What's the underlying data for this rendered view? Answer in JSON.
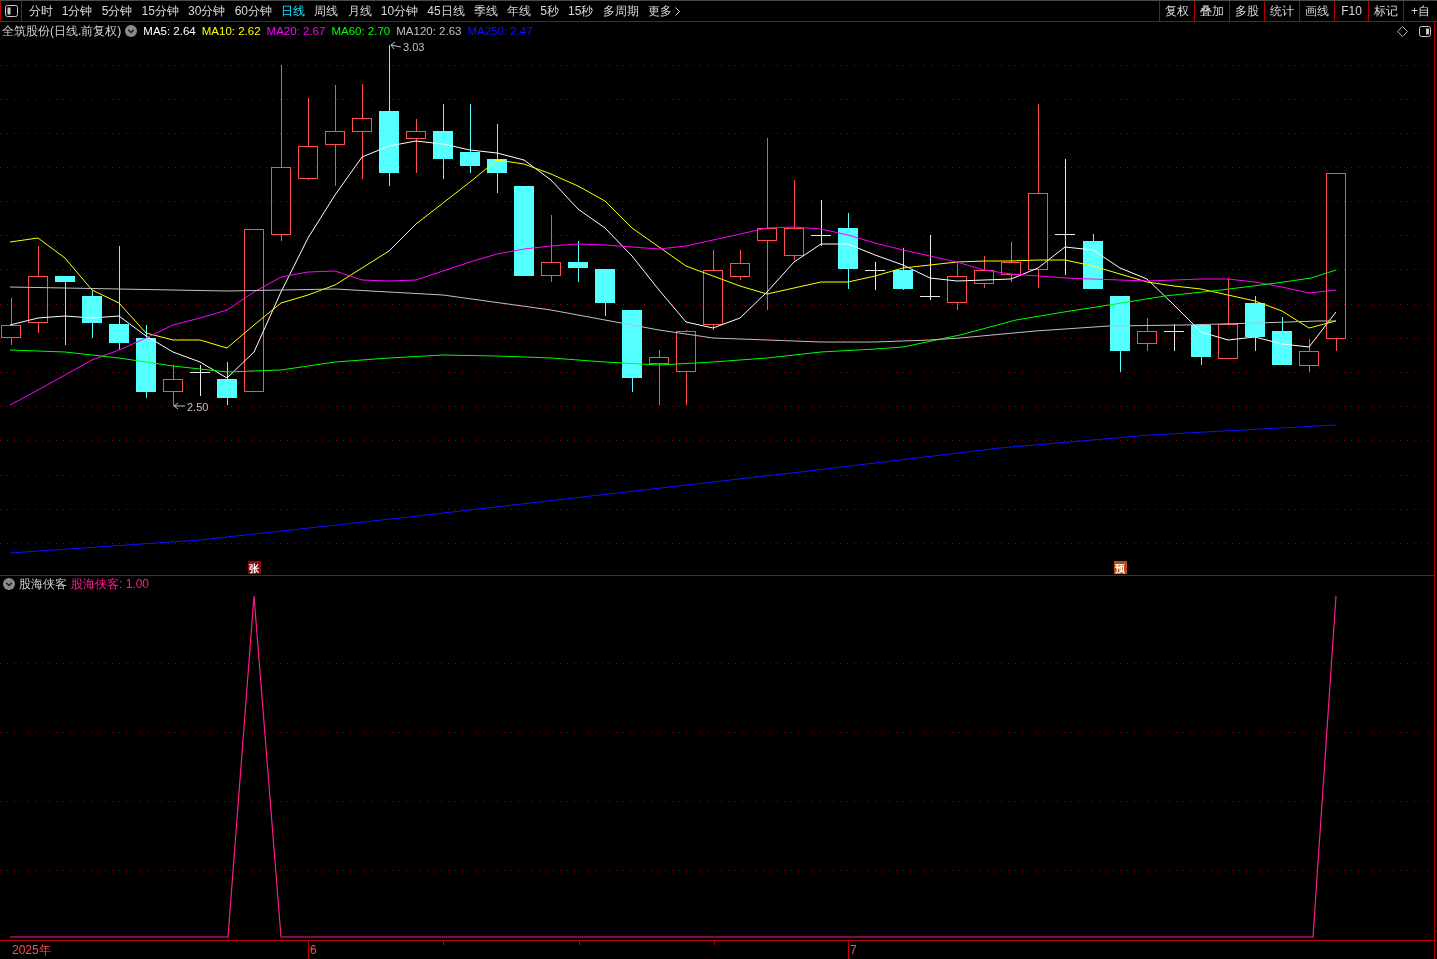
{
  "toolbar": {
    "periods": [
      {
        "label": "分时",
        "kind": "period",
        "selected": false
      },
      {
        "label": "1分钟",
        "kind": "period",
        "selected": false
      },
      {
        "label": "5分钟",
        "kind": "period",
        "selected": false
      },
      {
        "label": "15分钟",
        "kind": "period",
        "selected": false
      },
      {
        "label": "30分钟",
        "kind": "period",
        "selected": false
      },
      {
        "label": "60分钟",
        "kind": "period",
        "selected": false
      },
      {
        "label": "日线",
        "kind": "period",
        "selected": true
      },
      {
        "label": "周线",
        "kind": "period",
        "selected": false
      },
      {
        "label": "月线",
        "kind": "period",
        "selected": false
      },
      {
        "label": "10分钟",
        "kind": "period",
        "selected": false
      },
      {
        "label": "45日线",
        "kind": "period",
        "selected": false
      },
      {
        "label": "季线",
        "kind": "period",
        "selected": false
      },
      {
        "label": "年线",
        "kind": "period",
        "selected": false
      },
      {
        "label": "5秒",
        "kind": "period",
        "selected": false
      },
      {
        "label": "15秒",
        "kind": "period",
        "selected": false
      },
      {
        "label": "多周期",
        "kind": "period",
        "selected": false
      },
      {
        "label": "更多",
        "kind": "menu",
        "selected": false
      }
    ],
    "tools": [
      "复权",
      "叠加",
      "多股",
      "统计",
      "画线",
      "F10",
      "标记",
      "+自"
    ]
  },
  "legend": {
    "title": "全筑股份(日线.前复权)",
    "averages": [
      {
        "label": "MA5: 2.64",
        "color": "#ffffff"
      },
      {
        "label": "MA10: 2.62",
        "color": "#ffff00"
      },
      {
        "label": "MA20: 2.67",
        "color": "#ff00ff"
      },
      {
        "label": "MA60: 2.70",
        "color": "#00ff00"
      },
      {
        "label": "MA120: 2.63",
        "color": "#c0c0c0"
      },
      {
        "label": "MA250: 2.47",
        "color": "#1010ff"
      }
    ]
  },
  "chart": {
    "high_label": "3.03",
    "low_label": "2.50",
    "markers": [
      {
        "text": "张",
        "color": "#8b0a0a"
      },
      {
        "text": "预",
        "color": "#c0450e"
      }
    ]
  },
  "indicator": {
    "name": "股海侠客",
    "reading": "股海侠客: 1.00"
  },
  "time_axis": {
    "labels": [
      "2025年",
      "6",
      "7"
    ]
  }
}
